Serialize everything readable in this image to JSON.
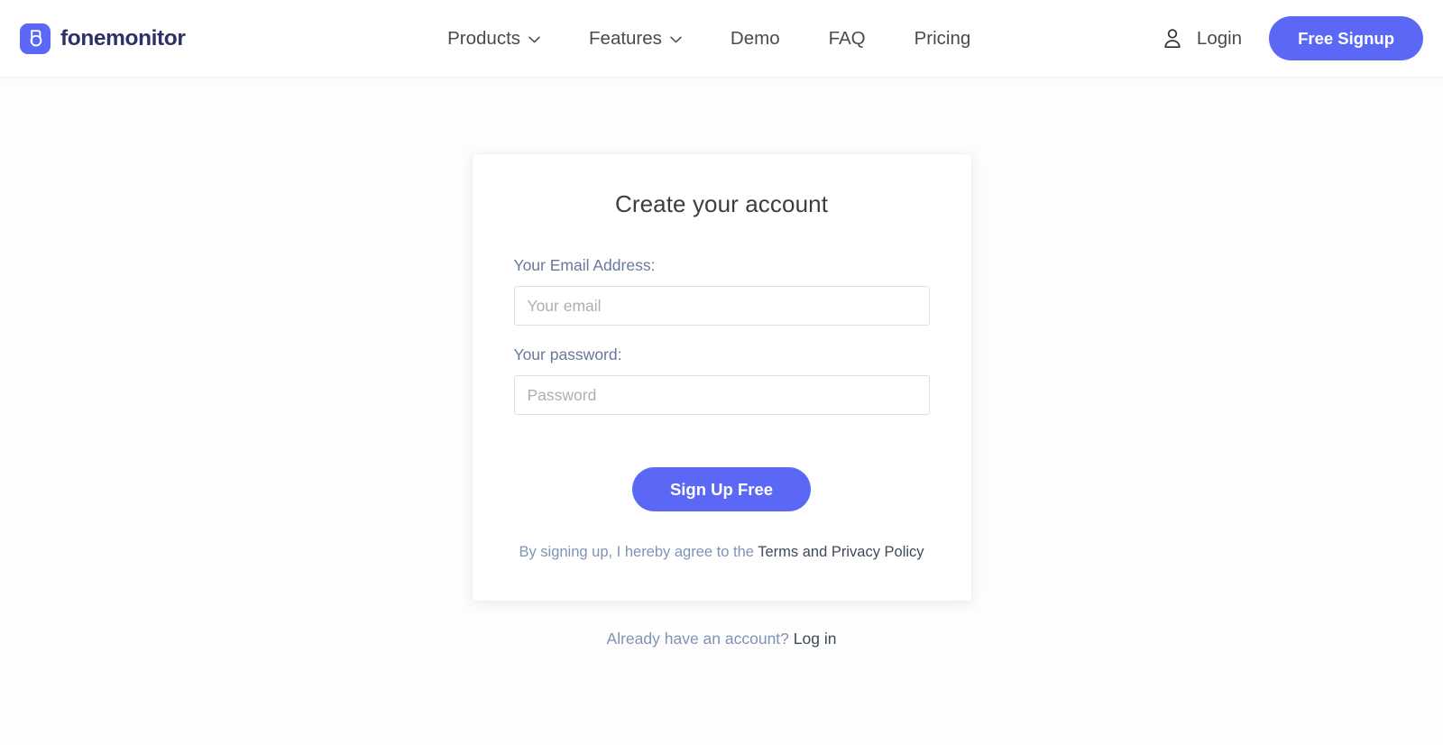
{
  "header": {
    "brand": {
      "name": "fonemonitor",
      "mark_icon": "fonemonitor-logo-icon",
      "mark_color": "#5a68f5",
      "name_color": "#2b3268"
    },
    "nav": [
      {
        "label": "Products",
        "has_dropdown": true,
        "icon": "chevron-down-icon"
      },
      {
        "label": "Features",
        "has_dropdown": true,
        "icon": "chevron-down-icon"
      },
      {
        "label": "Demo",
        "has_dropdown": false,
        "icon": ""
      },
      {
        "label": "FAQ",
        "has_dropdown": false,
        "icon": ""
      },
      {
        "label": "Pricing",
        "has_dropdown": false,
        "icon": ""
      }
    ],
    "login": {
      "icon": "user-icon",
      "label": "Login"
    },
    "signup_button": {
      "label": "Free Signup",
      "color": "#5a68f5"
    }
  },
  "signup_card": {
    "title": "Create your account",
    "email_field": {
      "label": "Your Email Address:",
      "placeholder": "Your email",
      "value": ""
    },
    "password_field": {
      "label": "Your password:",
      "placeholder": "Password",
      "value": ""
    },
    "submit_button": {
      "label": "Sign Up Free",
      "color": "#5a68f5"
    },
    "terms": {
      "prefix": "By signing up, I hereby agree to the ",
      "link": "Terms and Privacy Policy"
    }
  },
  "footer_prompt": {
    "text": "Already have an account? ",
    "link": "Log in"
  }
}
